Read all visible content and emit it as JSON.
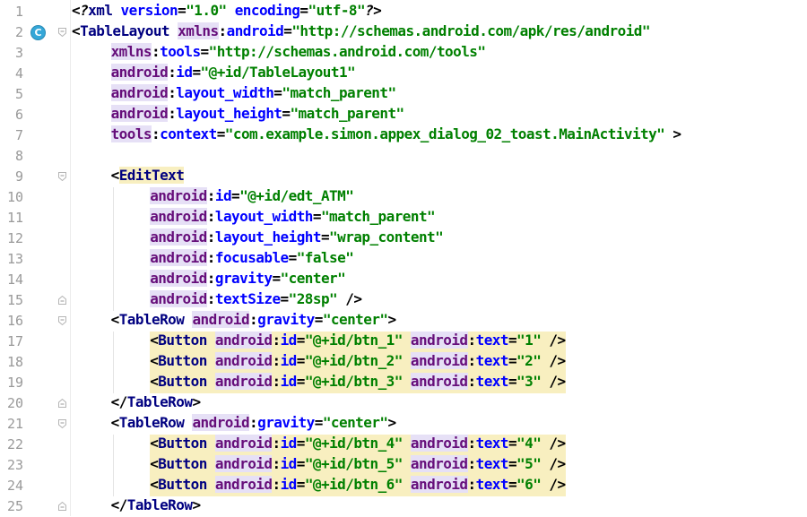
{
  "editor": {
    "file_language": "xml",
    "lines": [
      {
        "n": "1",
        "indent": 0,
        "text": "<?xml version=\"1.0\" encoding=\"utf-8\"?>"
      },
      {
        "n": "2",
        "indent": 0,
        "text": "<TableLayout xmlns:android=\"http://schemas.android.com/apk/res/android\""
      },
      {
        "n": "3",
        "indent": 1,
        "text": "xmlns:tools=\"http://schemas.android.com/tools\""
      },
      {
        "n": "4",
        "indent": 1,
        "text": "android:id=\"@+id/TableLayout1\""
      },
      {
        "n": "5",
        "indent": 1,
        "text": "android:layout_width=\"match_parent\""
      },
      {
        "n": "6",
        "indent": 1,
        "text": "android:layout_height=\"match_parent\""
      },
      {
        "n": "7",
        "indent": 1,
        "text": "tools:context=\"com.example.simon.appex_dialog_02_toast.MainActivity\" >"
      },
      {
        "n": "8",
        "indent": 0,
        "text": ""
      },
      {
        "n": "9",
        "indent": 1,
        "text": "<EditText"
      },
      {
        "n": "10",
        "indent": 2,
        "text": "android:id=\"@+id/edt_ATM\""
      },
      {
        "n": "11",
        "indent": 2,
        "text": "android:layout_width=\"match_parent\""
      },
      {
        "n": "12",
        "indent": 2,
        "text": "android:layout_height=\"wrap_content\""
      },
      {
        "n": "13",
        "indent": 2,
        "text": "android:focusable=\"false\""
      },
      {
        "n": "14",
        "indent": 2,
        "text": "android:gravity=\"center\""
      },
      {
        "n": "15",
        "indent": 2,
        "text": "android:textSize=\"28sp\" />"
      },
      {
        "n": "16",
        "indent": 1,
        "text": "<TableRow android:gravity=\"center\">"
      },
      {
        "n": "17",
        "indent": 2,
        "text": "<Button android:id=\"@+id/btn_1\" android:text=\"1\" />"
      },
      {
        "n": "18",
        "indent": 2,
        "text": "<Button android:id=\"@+id/btn_2\" android:text=\"2\" />"
      },
      {
        "n": "19",
        "indent": 2,
        "text": "<Button android:id=\"@+id/btn_3\" android:text=\"3\" />"
      },
      {
        "n": "20",
        "indent": 1,
        "text": "</TableRow>"
      },
      {
        "n": "21",
        "indent": 1,
        "text": "<TableRow android:gravity=\"center\">"
      },
      {
        "n": "22",
        "indent": 2,
        "text": "<Button android:id=\"@+id/btn_4\" android:text=\"4\" />"
      },
      {
        "n": "23",
        "indent": 2,
        "text": "<Button android:id=\"@+id/btn_5\" android:text=\"5\" />"
      },
      {
        "n": "24",
        "indent": 2,
        "text": "<Button android:id=\"@+id/btn_6\" android:text=\"6\" />"
      },
      {
        "n": "25",
        "indent": 1,
        "text": "</TableRow>"
      }
    ],
    "class_marker": {
      "line": "2",
      "letter": "C"
    },
    "fold_markers": [
      {
        "line": "2",
        "kind": "open"
      },
      {
        "line": "9",
        "kind": "open"
      },
      {
        "line": "15",
        "kind": "close"
      },
      {
        "line": "16",
        "kind": "open"
      },
      {
        "line": "20",
        "kind": "close"
      },
      {
        "line": "21",
        "kind": "open"
      },
      {
        "line": "25",
        "kind": "close"
      }
    ],
    "highlighted_lines": [
      "17",
      "18",
      "19",
      "22",
      "23",
      "24"
    ],
    "colors": {
      "tag": "#000080",
      "namespace": "#660e7a",
      "attribute": "#0000ff",
      "string": "#008000",
      "line_number": "#999999",
      "tag_highlight": "#f8efc0",
      "namespace_highlight": "#e6e0f6"
    }
  }
}
